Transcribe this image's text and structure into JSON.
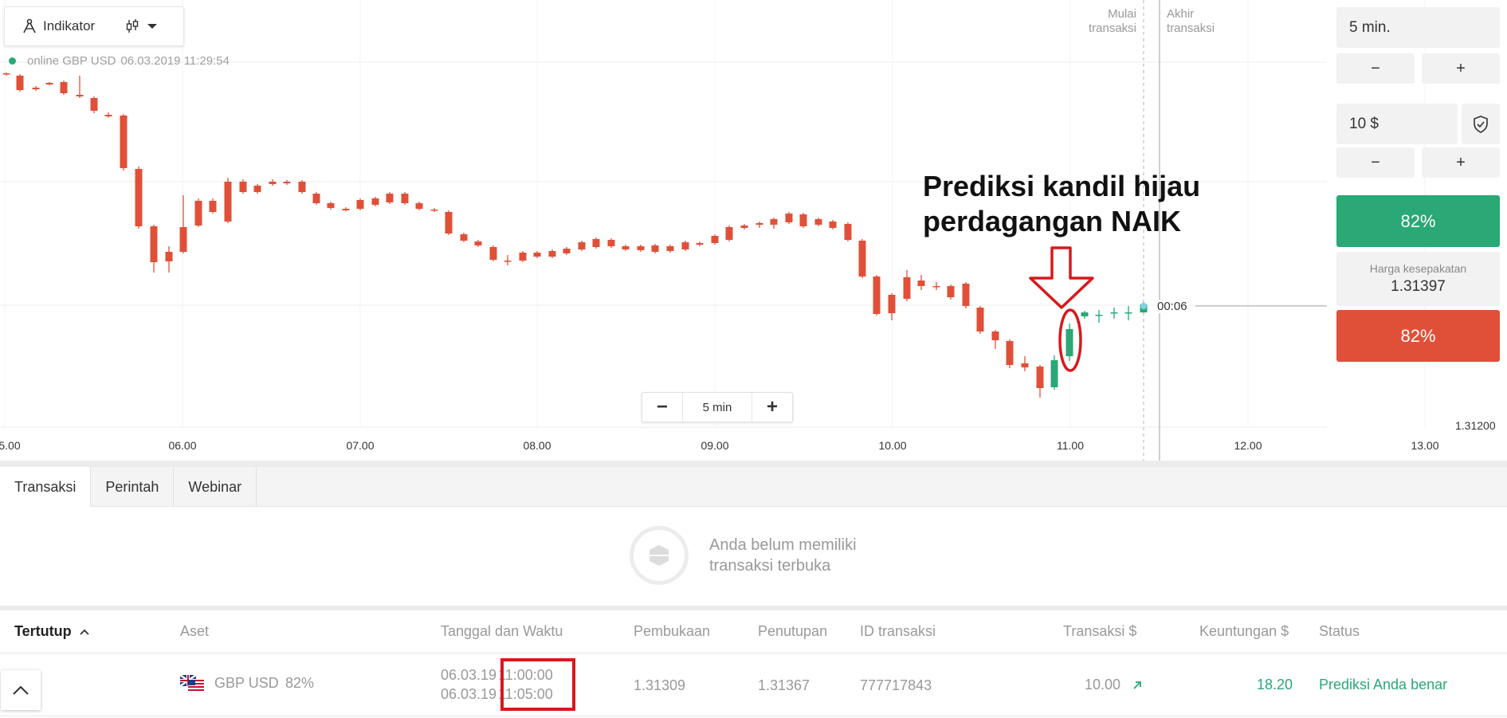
{
  "toolbar": {
    "indicator_label": "Indikator"
  },
  "status": {
    "text": "online GBP USD",
    "datetime": "06.03.2019 11:29:54"
  },
  "deal_labels": {
    "start": [
      "Mulai",
      "transaksi"
    ],
    "end": [
      "Akhir",
      "transaksi"
    ]
  },
  "zoom": {
    "minus": "−",
    "value": "5 min",
    "plus": "+"
  },
  "annotation": {
    "line1": "Prediksi kandil hijau",
    "line2": "perdagangan NAIK"
  },
  "chart": {
    "x_labels": [
      "5.00",
      "06.00",
      "07.00",
      "08.00",
      "09.00",
      "10.00",
      "11.00",
      "12.00",
      "13.00"
    ],
    "timer": "00:06",
    "price_low": "1.31200",
    "colors": {
      "up": "#2aa876",
      "down": "#e05038",
      "annotation": "#d7191c"
    }
  },
  "panel": {
    "time": "5 min.",
    "minus": "−",
    "plus": "+",
    "amount": "10 $",
    "up_label": "82%",
    "price_caption": "Harga kesepakatan",
    "price_value": "1.31397",
    "down_label": "82%"
  },
  "tabs": [
    "Transaksi",
    "Perintah",
    "Webinar"
  ],
  "empty": {
    "line1": "Anda belum memiliki",
    "line2": "transaksi terbuka"
  },
  "closed_table": {
    "headers": [
      "Tertutup",
      "Aset",
      "Tanggal dan Waktu",
      "Pembukaan",
      "Penutupan",
      "ID transaksi",
      "Transaksi $",
      "Keuntungan $",
      "Status"
    ],
    "row": {
      "asset": "GBP USD",
      "percent": "82%",
      "date1": "06.03.19",
      "time1": "11:00:00",
      "date2": "06.03.19",
      "time2": "11:05:00",
      "open": "1.31309",
      "close": "1.31367",
      "id": "777717843",
      "amount": "10.00",
      "profit": "18.20",
      "status": "Prediksi Anda benar"
    }
  }
}
